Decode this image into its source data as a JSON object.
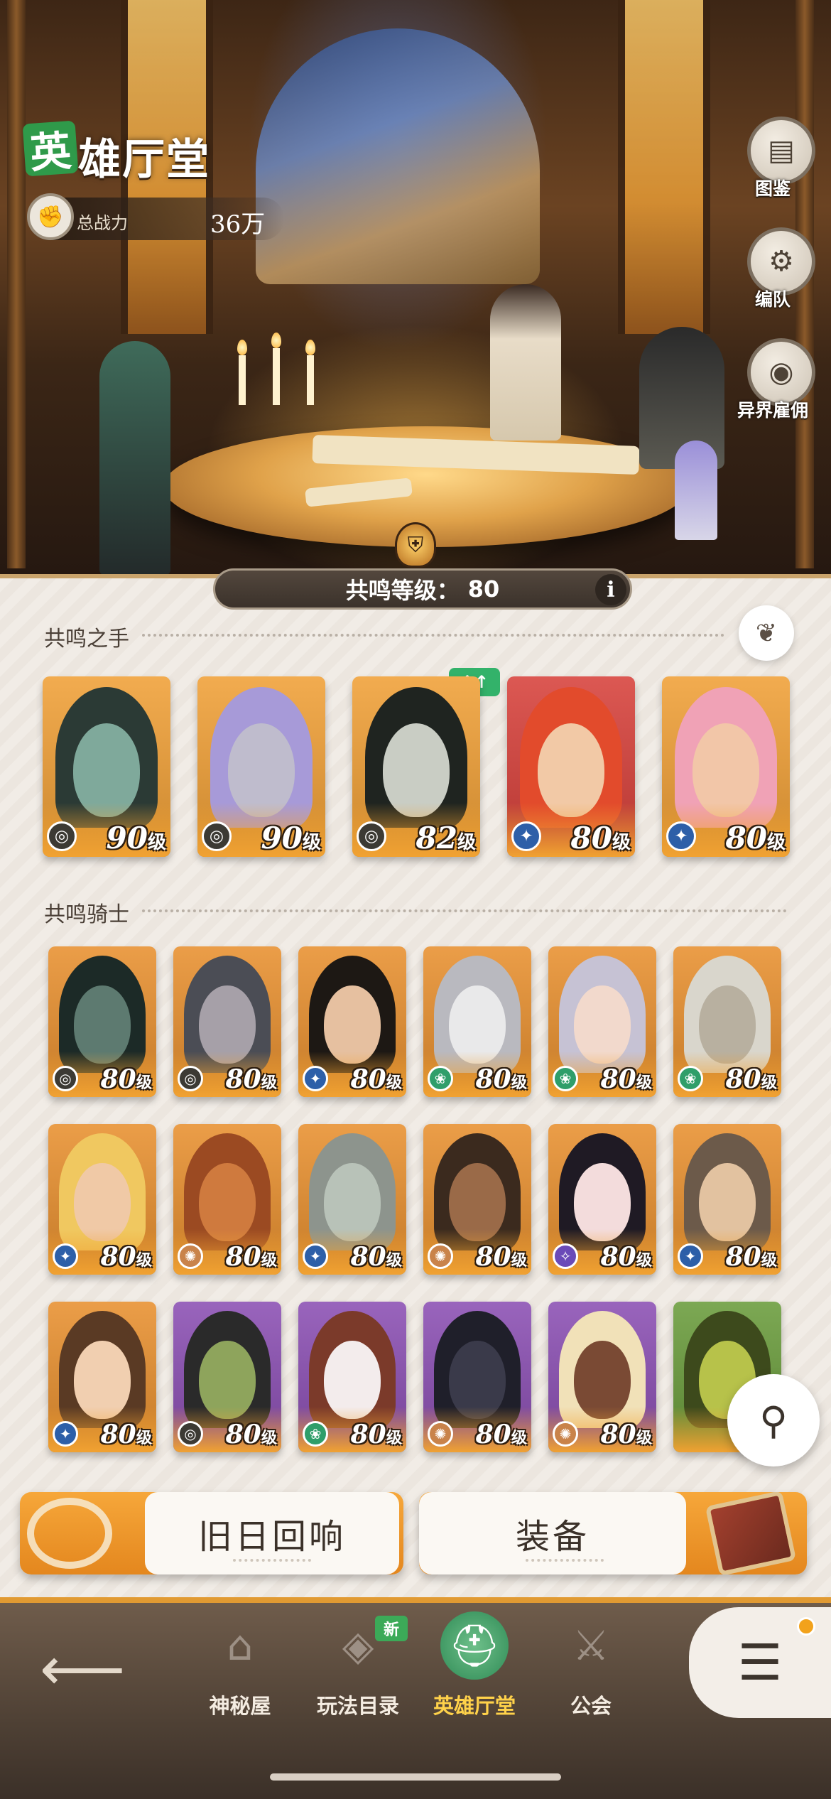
{
  "header": {
    "title_badge": "英",
    "title_rest": "雄厅堂",
    "power_label": "总战力",
    "power_value": "36万",
    "icons": {
      "power": "fist-icon"
    }
  },
  "side_menu": [
    {
      "label": "图鉴",
      "icon": "book-icon"
    },
    {
      "label": "编队",
      "icon": "helmet-gear-icon"
    },
    {
      "label": "异界雇佣",
      "icon": "portal-eye-icon"
    }
  ],
  "resonance": {
    "label": "共鸣等级：",
    "value": "80",
    "info": "i"
  },
  "hands_section": {
    "title": "共鸣之手",
    "upgrade_tag": "↑↑",
    "heroes": [
      {
        "level": "90",
        "unit": "级",
        "faction": "graveborn",
        "bg": "#f0a037",
        "skin": "#7fa99b",
        "hair": "#2b3a35"
      },
      {
        "level": "90",
        "unit": "级",
        "faction": "graveborn",
        "bg": "#f0a037",
        "skin": "#bfbccd",
        "hair": "#a79ad8"
      },
      {
        "level": "82",
        "unit": "级",
        "faction": "graveborn",
        "bg": "#f0a037",
        "skin": "#c9cdc4",
        "hair": "#1f2420"
      },
      {
        "level": "80",
        "unit": "级",
        "faction": "lightbearer",
        "bg": "#d7413b",
        "skin": "#f2c9a6",
        "hair": "#e24b2c"
      },
      {
        "level": "80",
        "unit": "级",
        "faction": "lightbearer",
        "bg": "#f0a037",
        "skin": "#f2c6a8",
        "hair": "#f0a2b6"
      }
    ]
  },
  "knights_section": {
    "title": "共鸣骑士",
    "heroes": [
      {
        "level": "80",
        "unit": "级",
        "faction": "graveborn",
        "bg": "#e8902f",
        "skin": "#5d7a70",
        "hair": "#1c2a27"
      },
      {
        "level": "80",
        "unit": "级",
        "faction": "graveborn",
        "bg": "#e8902f",
        "skin": "#a6a0a8",
        "hair": "#4b4d55"
      },
      {
        "level": "80",
        "unit": "级",
        "faction": "lightbearer",
        "bg": "#e8902f",
        "skin": "#e6c0a0",
        "hair": "#1d1814"
      },
      {
        "level": "80",
        "unit": "级",
        "faction": "wilder",
        "bg": "#e8902f",
        "skin": "#e9e9ea",
        "hair": "#b9b9bf"
      },
      {
        "level": "80",
        "unit": "级",
        "faction": "wilder",
        "bg": "#e8902f",
        "skin": "#f2d9cc",
        "hair": "#c6c2d4"
      },
      {
        "level": "80",
        "unit": "级",
        "faction": "wilder",
        "bg": "#e8902f",
        "skin": "#b8b0a0",
        "hair": "#d9d6cc"
      },
      {
        "level": "80",
        "unit": "级",
        "faction": "lightbearer",
        "bg": "#e8902f",
        "skin": "#f0c9a6",
        "hair": "#f0c860"
      },
      {
        "level": "80",
        "unit": "级",
        "faction": "mauler",
        "bg": "#e8902f",
        "skin": "#cf7a3e",
        "hair": "#9b4a22"
      },
      {
        "level": "80",
        "unit": "级",
        "faction": "lightbearer",
        "bg": "#e8902f",
        "skin": "#b8c2b8",
        "hair": "#8d948d"
      },
      {
        "level": "80",
        "unit": "级",
        "faction": "mauler",
        "bg": "#e8902f",
        "skin": "#9a6a48",
        "hair": "#3b2a1e"
      },
      {
        "level": "80",
        "unit": "级",
        "faction": "celestial",
        "bg": "#e8902f",
        "skin": "#f3dcdc",
        "hair": "#1f1a24"
      },
      {
        "level": "80",
        "unit": "级",
        "faction": "lightbearer",
        "bg": "#e8902f",
        "skin": "#e2c2a0",
        "hair": "#6c5a4a"
      },
      {
        "level": "80",
        "unit": "级",
        "faction": "lightbearer",
        "bg": "#e8902f",
        "skin": "#f1cfb0",
        "hair": "#5a3a24"
      },
      {
        "level": "80",
        "unit": "级",
        "faction": "graveborn",
        "bg": "#8b4fb3",
        "skin": "#8ea45c",
        "hair": "#2a2a2a"
      },
      {
        "level": "80",
        "unit": "级",
        "faction": "wilder",
        "bg": "#8b4fb3",
        "skin": "#f3ecec",
        "hair": "#7b3a2a"
      },
      {
        "level": "80",
        "unit": "级",
        "faction": "mauler",
        "bg": "#8b4fb3",
        "skin": "#3a3a4a",
        "hair": "#1f1f2a"
      },
      {
        "level": "80",
        "unit": "级",
        "faction": "mauler",
        "bg": "#8b4fb3",
        "skin": "#7a4a34",
        "hair": "#f1e1b8"
      },
      {
        "level": "",
        "unit": "",
        "faction": "",
        "bg": "#6a9c3c",
        "skin": "#b7c24a",
        "hair": "#3d4a1c"
      }
    ]
  },
  "actions": [
    {
      "label": "旧日回响",
      "icon": "ring-icon"
    },
    {
      "label": "装备",
      "icon": "shield-sword-icon"
    }
  ],
  "nav": {
    "back_icon": "back-arrow-icon",
    "items": [
      {
        "label": "神秘屋",
        "icon": "mystery-house-icon",
        "active": false
      },
      {
        "label": "玩法目录",
        "icon": "diamond-grid-icon",
        "active": false,
        "badge": "新"
      },
      {
        "label": "英雄厅堂",
        "icon": "knight-helmet-icon",
        "active": true
      },
      {
        "label": "公会",
        "icon": "crossed-swords-icon",
        "active": false
      }
    ],
    "menu_icon": "menu-lines-icon"
  },
  "colors": {
    "accent_orange": "#e19a32",
    "active_label": "#ffd24a",
    "graveborn": "#3c3a34",
    "lightbearer": "#2d5fa8",
    "wilder": "#2f9e6a",
    "mauler": "#c9834a",
    "celestial": "#6a4ab8"
  }
}
